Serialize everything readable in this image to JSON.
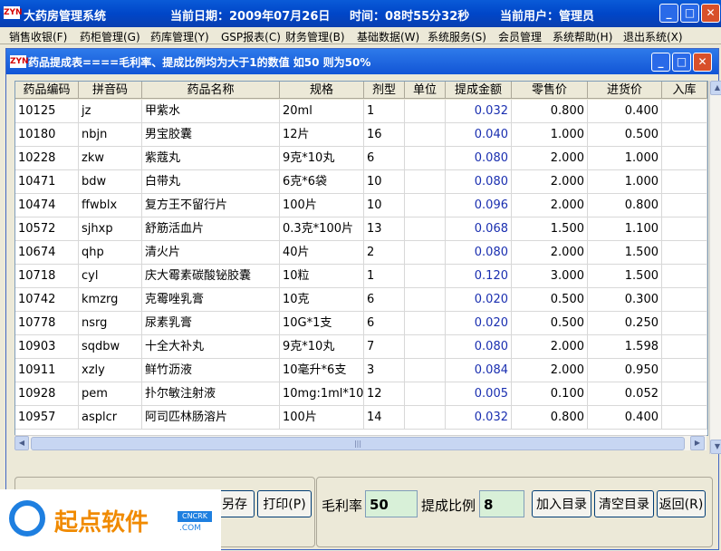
{
  "app": {
    "title": "大药房管理系统",
    "date_label": "当前日期：2009年07月26日",
    "time_label": "时间：08时55分32秒",
    "user_label": "当前用户：管理员",
    "logo": "ZYN"
  },
  "menu": [
    "销售收银(F)",
    "药柜管理(G)",
    "药库管理(Y)",
    "GSP报表(C)",
    "财务管理(B)",
    "基础数据(W)",
    "系统服务(S)",
    "会员管理",
    "系统帮助(H)",
    "退出系统(X)"
  ],
  "window": {
    "title": "药品提成表====毛利率、提成比例均为大于1的数值   如50 则为50%"
  },
  "table": {
    "headers": [
      "药品编码",
      "拼音码",
      "药品名称",
      "规格",
      "剂型",
      "单位",
      "提成金额",
      "零售价",
      "进货价",
      "入库"
    ],
    "rows": [
      [
        "10125",
        "jz",
        "甲紫水",
        "20ml",
        "1",
        "",
        "0.032",
        "0.800",
        "0.400"
      ],
      [
        "10180",
        "nbjn",
        "男宝胶囊",
        "12片",
        "16",
        "",
        "0.040",
        "1.000",
        "0.500"
      ],
      [
        "10228",
        "zkw",
        "紫蔻丸",
        "9克*10丸",
        "6",
        "",
        "0.080",
        "2.000",
        "1.000"
      ],
      [
        "10471",
        "bdw",
        "白带丸",
        "6克*6袋",
        "10",
        "",
        "0.080",
        "2.000",
        "1.000"
      ],
      [
        "10474",
        "ffwblx",
        "复方王不留行片",
        "100片",
        "10",
        "",
        "0.096",
        "2.000",
        "0.800"
      ],
      [
        "10572",
        "sjhxp",
        "舒筋活血片",
        "0.3克*100片",
        "13",
        "",
        "0.068",
        "1.500",
        "1.100"
      ],
      [
        "10674",
        "qhp",
        "清火片",
        "40片",
        "2",
        "",
        "0.080",
        "2.000",
        "1.500"
      ],
      [
        "10718",
        "cyl",
        "庆大霉素碳酸铋胶囊",
        "10粒",
        "1",
        "",
        "0.120",
        "3.000",
        "1.500"
      ],
      [
        "10742",
        "kmzrg",
        "克霉唑乳膏",
        "10克",
        "6",
        "",
        "0.020",
        "0.500",
        "0.300"
      ],
      [
        "10778",
        "nsrg",
        "尿素乳膏",
        "10G*1支",
        "6",
        "",
        "0.020",
        "0.500",
        "0.250"
      ],
      [
        "10903",
        "sqdbw",
        "十全大补丸",
        "9克*10丸",
        "7",
        "",
        "0.080",
        "2.000",
        "1.598"
      ],
      [
        "10911",
        "xzly",
        "鲜竹沥液",
        "10毫升*6支",
        "3",
        "",
        "0.084",
        "2.000",
        "0.950"
      ],
      [
        "10928",
        "pem",
        "扑尔敏注射液",
        "10mg:1ml*10",
        "12",
        "",
        "0.005",
        "0.100",
        "0.052"
      ],
      [
        "10957",
        "asplcr",
        "阿司匹林肠溶片",
        "100片",
        "14",
        "",
        "0.032",
        "0.800",
        "0.400"
      ]
    ]
  },
  "controls": {
    "save_as": "另存",
    "print": "打印(P)",
    "margin_label": "毛利率",
    "margin_value": "50",
    "commission_label": "提成比例",
    "commission_value": "8",
    "add_catalog": "加入目录",
    "clear_catalog": "清空目录",
    "back": "返回(R)"
  },
  "watermark": {
    "text": "起点软件",
    "badge": "CNCRK",
    "domain": ".COM"
  },
  "colors": {
    "titlebar": "#0a5bd8",
    "amount_text": "#1a2fb0",
    "input_bg": "#d8f0d8"
  }
}
